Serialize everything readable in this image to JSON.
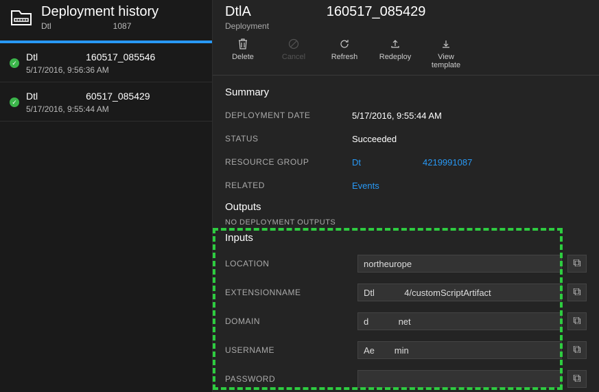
{
  "left": {
    "title": "Deployment history",
    "subtitle_prefix": "Dtl",
    "subtitle_suffix": "1087",
    "items": [
      {
        "name_prefix": "Dtl",
        "name_suffix": "160517_085546",
        "time": "5/17/2016, 9:56:36 AM"
      },
      {
        "name_prefix": "Dtl",
        "name_suffix": "60517_085429",
        "time": "5/17/2016, 9:55:44 AM"
      }
    ]
  },
  "detail": {
    "title_prefix": "DtlA",
    "title_suffix": "160517_085429",
    "subtitle": "Deployment",
    "toolbar": {
      "delete": "Delete",
      "cancel": "Cancel",
      "refresh": "Refresh",
      "redeploy": "Redeploy",
      "view_template": "View template"
    },
    "summary_label": "Summary",
    "dep_date_label": "DEPLOYMENT DATE",
    "dep_date": "5/17/2016, 9:55:44 AM",
    "status_label": "STATUS",
    "status": "Succeeded",
    "rg_label": "RESOURCE GROUP",
    "rg_prefix": "Dt",
    "rg_suffix": "4219991087",
    "related_label": "RELATED",
    "related": "Events",
    "outputs_label": "Outputs",
    "no_outputs": "NO DEPLOYMENT OUTPUTS",
    "inputs_label": "Inputs",
    "inputs": {
      "location_label": "LOCATION",
      "location": "northeurope",
      "ext_label": "EXTENSIONNAME",
      "ext_prefix": "Dtl",
      "ext_suffix": "4/customScriptArtifact",
      "domain_label": "DOMAIN",
      "domain_prefix": "d",
      "domain_suffix": "net",
      "user_label": "USERNAME",
      "user_prefix": "Ae",
      "user_suffix": "min",
      "pass_label": "PASSWORD",
      "pass": ""
    }
  }
}
